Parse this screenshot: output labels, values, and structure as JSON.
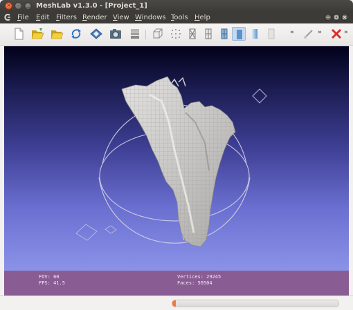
{
  "window": {
    "title": "MeshLab v1.3.0 - [Project_1]",
    "close_glyph": "×",
    "min_glyph": "–",
    "max_glyph": "□"
  },
  "menubar": {
    "app_icon": "meshlab-icon",
    "items": [
      {
        "label": "File"
      },
      {
        "label": "Edit"
      },
      {
        "label": "Filters"
      },
      {
        "label": "Render"
      },
      {
        "label": "View"
      },
      {
        "label": "Windows"
      },
      {
        "label": "Tools"
      },
      {
        "label": "Help"
      }
    ],
    "mdi_buttons": [
      "minimize-icon",
      "restore-icon",
      "close-icon"
    ]
  },
  "toolbar": {
    "buttons": [
      {
        "name": "new-project",
        "icon": "new-file-icon"
      },
      {
        "name": "open",
        "icon": "open-folder-icon"
      },
      {
        "name": "open-project",
        "icon": "folder-icon"
      },
      {
        "name": "reload",
        "icon": "reload-icon"
      },
      {
        "name": "save",
        "icon": "save-icon"
      },
      {
        "name": "snapshot",
        "icon": "camera-icon"
      },
      {
        "name": "layers",
        "icon": "layers-icon"
      },
      {
        "name": "bbox",
        "icon": "bounding-box-icon"
      },
      {
        "name": "points",
        "icon": "points-icon"
      },
      {
        "name": "wireframe",
        "icon": "wireframe-icon"
      },
      {
        "name": "hidden-lines",
        "icon": "hidden-lines-icon"
      },
      {
        "name": "flat-lines",
        "icon": "flat-lines-icon"
      },
      {
        "name": "flat",
        "icon": "flat-shading-icon",
        "active": true
      },
      {
        "name": "smooth",
        "icon": "smooth-shading-icon"
      },
      {
        "name": "texture",
        "icon": "texture-icon"
      },
      {
        "name": "measure",
        "icon": "measure-icon"
      },
      {
        "name": "delete",
        "icon": "delete-icon"
      }
    ],
    "overflow_glyph": "»"
  },
  "colors": {
    "accent": "#f07746",
    "infobar": "#8a5c94",
    "mesh": "#d9d8d6"
  },
  "infobar": {
    "fov": "FOV: 60",
    "fps": "FPS:   41.5",
    "vertices": "Vertices: 29245",
    "faces": "Faces: 56504"
  },
  "statusbar": {
    "progress": 0.01
  }
}
